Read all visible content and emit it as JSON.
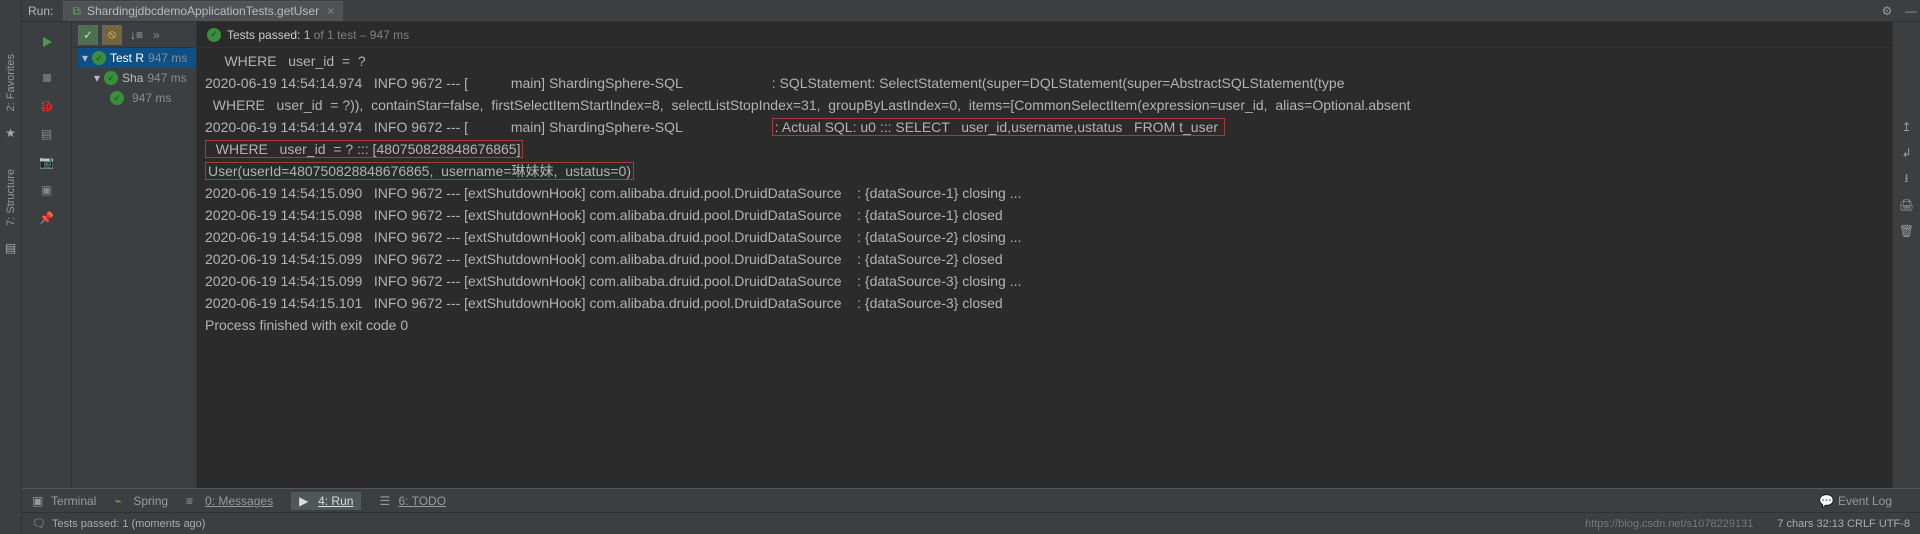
{
  "header": {
    "runLabel": "Run:",
    "tabIcon": "test-tab-icon",
    "tabTitle": "ShardingjdbcdemoApplicationTests.getUser"
  },
  "leftRail": {
    "items": [
      "2: Favorites",
      "7: Structure"
    ]
  },
  "gutter": {
    "run": "run-icon",
    "debug": "debug-icon",
    "stop": "stop-icon",
    "layout": "layout-icon",
    "camera": "camera-icon",
    "pin": "pin-icon"
  },
  "summary": {
    "prefix": "Tests passed:",
    "count": "1",
    "of": "of 1 test",
    "time": "– 947 ms"
  },
  "tree": {
    "items": [
      {
        "label": "Test R",
        "time": "947 ms",
        "selected": true,
        "indent": 0
      },
      {
        "label": "Sha",
        "time": "947 ms",
        "selected": false,
        "indent": 1
      },
      {
        "label": "",
        "time": "947 ms",
        "selected": false,
        "indent": 2
      }
    ]
  },
  "console": {
    "lines": [
      {
        "text": "     WHERE   user_id  =  ?"
      },
      {
        "text": "2020-06-19 14:54:14.974   INFO 9672 --- [           main] ShardingSphere-SQL                       : SQLStatement: SelectStatement(super=DQLStatement(super=AbstractSQLStatement(type"
      },
      {
        "text": "  WHERE   user_id  = ?)),  containStar=false,  firstSelectItemStartIndex=8,  selectListStopIndex=31,  groupByLastIndex=0,  items=[CommonSelectItem(expression=user_id,  alias=Optional.absent"
      },
      {
        "pre": "2020-06-19 14:54:14.974   INFO 9672 --- [           main] ShardingSphere-SQL                       ",
        "hl": ": Actual SQL: u0 ::: SELECT   user_id,username,ustatus   FROM t_user "
      },
      {
        "hl": "  WHERE   user_id  = ? ::: [480750828848676865]",
        "post": ""
      },
      {
        "hl": "User(userId=480750828848676865,  username=琳妹妹,  ustatus=0)",
        "post": ""
      },
      {
        "text": "2020-06-19 14:54:15.090   INFO 9672 --- [extShutdownHook] com.alibaba.druid.pool.DruidDataSource    : {dataSource-1} closing ..."
      },
      {
        "text": "2020-06-19 14:54:15.098   INFO 9672 --- [extShutdownHook] com.alibaba.druid.pool.DruidDataSource    : {dataSource-1} closed"
      },
      {
        "text": "2020-06-19 14:54:15.098   INFO 9672 --- [extShutdownHook] com.alibaba.druid.pool.DruidDataSource    : {dataSource-2} closing ..."
      },
      {
        "text": "2020-06-19 14:54:15.099   INFO 9672 --- [extShutdownHook] com.alibaba.druid.pool.DruidDataSource    : {dataSource-2} closed"
      },
      {
        "text": "2020-06-19 14:54:15.099   INFO 9672 --- [extShutdownHook] com.alibaba.druid.pool.DruidDataSource    : {dataSource-3} closing ..."
      },
      {
        "text": "2020-06-19 14:54:15.101   INFO 9672 --- [extShutdownHook] com.alibaba.druid.pool.DruidDataSource    : {dataSource-3} closed"
      },
      {
        "text": ""
      },
      {
        "text": "Process finished with exit code 0"
      }
    ]
  },
  "bottomTabs": {
    "terminal": "Terminal",
    "spring": "Spring",
    "messages": "0: Messages",
    "run": "4: Run",
    "todo": "6: TODO",
    "eventLog": "Event Log"
  },
  "status": {
    "left": "Tests passed: 1 (moments ago)",
    "right": "7 chars    32:13    CRLF    UTF-8",
    "watermark": "https://blog.csdn.net/s1078229131"
  }
}
